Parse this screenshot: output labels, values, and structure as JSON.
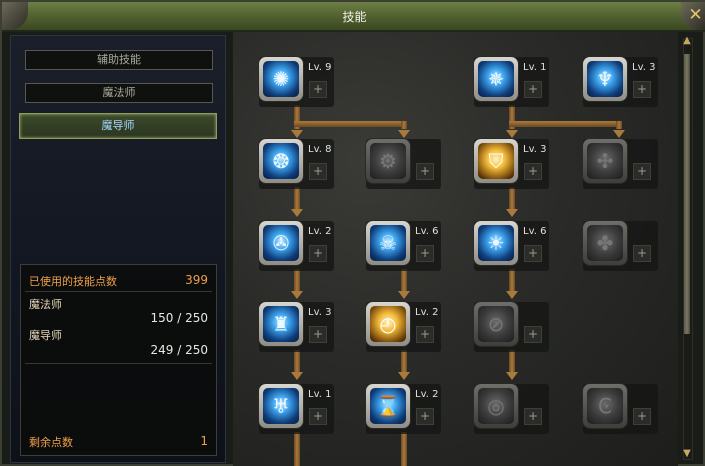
{
  "window": {
    "title": "技能",
    "close_glyph": "✕"
  },
  "categories": [
    {
      "label": "辅助技能",
      "active": false
    },
    {
      "label": "魔法师",
      "active": false
    },
    {
      "label": "魔导师",
      "active": true
    }
  ],
  "stats": {
    "used_label": "已使用的技能点数",
    "used_value": "399",
    "class1_label": "魔法师",
    "class1_value": "150 / 250",
    "class2_label": "魔导师",
    "class2_value": "249 / 250",
    "remaining_label": "剩余点数",
    "remaining_value": "1"
  },
  "skills": [
    {
      "icon": "orb-burst-icon",
      "glyph": "✺",
      "level": "Lv. 9",
      "locked": false,
      "tone": "blue"
    },
    {
      "icon": "star-flare-icon",
      "glyph": "✵",
      "level": "Lv. 1",
      "locked": false,
      "tone": "blue"
    },
    {
      "icon": "figure-icon",
      "glyph": "♆",
      "level": "Lv. 3",
      "locked": false,
      "tone": "blue"
    },
    {
      "icon": "triple-orb-icon",
      "glyph": "❂",
      "level": "Lv. 8",
      "locked": false,
      "tone": "blue"
    },
    {
      "icon": "locked-gear-icon",
      "glyph": "⚙",
      "level": "",
      "locked": true,
      "tone": "gray"
    },
    {
      "icon": "shield-crest-icon",
      "glyph": "⛉",
      "level": "Lv. 3",
      "locked": false,
      "tone": "gold"
    },
    {
      "icon": "locked-swirl-icon",
      "glyph": "✣",
      "level": "",
      "locked": true,
      "tone": "gray"
    },
    {
      "icon": "vortex-icon",
      "glyph": "✇",
      "level": "Lv. 2",
      "locked": false,
      "tone": "blue"
    },
    {
      "icon": "skull-icon",
      "glyph": "☠",
      "level": "Lv. 6",
      "locked": false,
      "tone": "blue"
    },
    {
      "icon": "fan-burst-icon",
      "glyph": "☀",
      "level": "Lv. 6",
      "locked": false,
      "tone": "blue"
    },
    {
      "icon": "locked-claw-icon",
      "glyph": "✤",
      "level": "",
      "locked": true,
      "tone": "gray"
    },
    {
      "icon": "pillar-icon",
      "glyph": "♜",
      "level": "Lv. 3",
      "locked": false,
      "tone": "blue"
    },
    {
      "icon": "clock-skull-icon",
      "glyph": "◴",
      "level": "Lv. 2",
      "locked": false,
      "tone": "gold"
    },
    {
      "icon": "locked-slash-icon",
      "glyph": "⊘",
      "level": "",
      "locked": true,
      "tone": "gray"
    },
    {
      "icon": "bird-icon",
      "glyph": "♅",
      "level": "Lv. 1",
      "locked": false,
      "tone": "blue"
    },
    {
      "icon": "hourglass-icon",
      "glyph": "⌛",
      "level": "Lv. 2",
      "locked": false,
      "tone": "blue"
    },
    {
      "icon": "locked-ring-icon",
      "glyph": "◎",
      "level": "",
      "locked": true,
      "tone": "gray"
    },
    {
      "icon": "locked-c-icon",
      "glyph": "Ͼ",
      "level": "",
      "locked": true,
      "tone": "gray"
    }
  ],
  "plus_glyph": "+",
  "colors": {
    "accent": "#f0a04a",
    "title_bar": "#4f5f2e",
    "active_tab_text": "#a7d7ff"
  },
  "scroll": {
    "up": "▲",
    "down": "▼"
  }
}
